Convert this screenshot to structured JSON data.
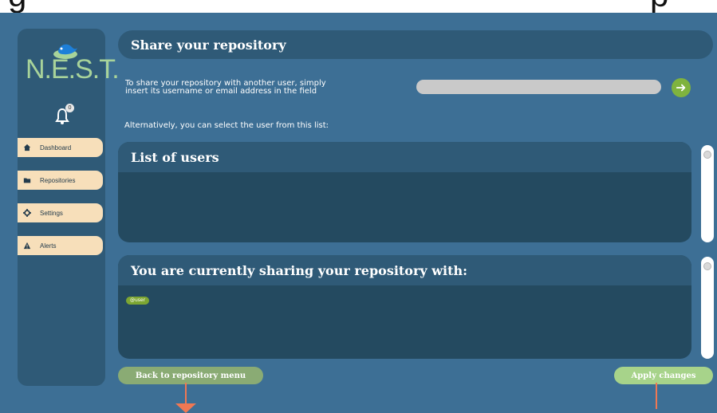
{
  "title_strip": {
    "left": "g",
    "right": "p"
  },
  "sidebar": {
    "logo": {
      "text": "N.E.S.T."
    },
    "notifications": {
      "count": "0"
    },
    "items": [
      {
        "label": "Dashboard",
        "icon": "home-icon"
      },
      {
        "label": "Repositories",
        "icon": "folder-icon"
      },
      {
        "label": "Settings",
        "icon": "gear-icon"
      },
      {
        "label": "Alerts",
        "icon": "warning-icon"
      }
    ]
  },
  "main": {
    "title": "Share your repository",
    "intro_line1": "To share your repository with another user, simply",
    "intro_line2": "insert its username or email address in the field",
    "input_value": "",
    "alternative_text": "Alternatively, you can select the user from this list:",
    "list_panel_title": "List of users",
    "sharing_panel_title": "You are currently sharing your repository with:",
    "shared_users": [
      "@user"
    ],
    "buttons": {
      "back": "Back to repository menu",
      "apply": "Apply changes"
    }
  },
  "colors": {
    "background": "#3d6f95",
    "panel": "#2f5a77",
    "accent_green": "#7fb33e",
    "nav_bg": "#f7dfba",
    "arrow": "#f07853"
  }
}
